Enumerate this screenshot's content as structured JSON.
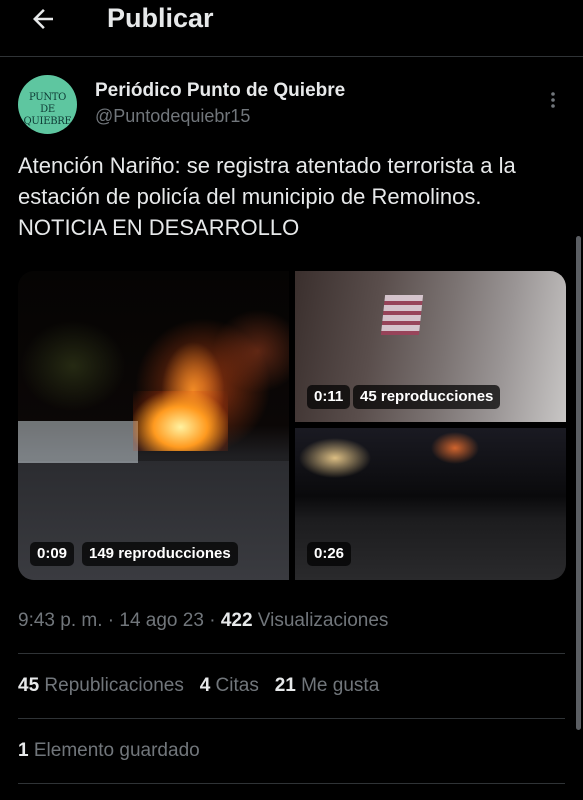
{
  "header": {
    "title": "Publicar",
    "back_icon": "arrow-left-icon"
  },
  "author": {
    "name": "Periódico Punto de Quiebre",
    "handle": "@Puntodequiebr15",
    "avatar_line1": "PUNTO",
    "avatar_line2": "DE QUIEBRE",
    "avatar_color": "#5ec6a0"
  },
  "tweet": {
    "text": "Atención Nariño: se registra atentado terrorista a la estación de policía del municipio de Remolinos. NOTICIA EN DESARROLLO"
  },
  "media": [
    {
      "duration": "0:09",
      "views": "149 reproducciones"
    },
    {
      "duration": "0:11",
      "views": "45 reproducciones"
    },
    {
      "duration": "0:26"
    }
  ],
  "stats": {
    "time": "9:43 p. m.",
    "sep1": "·",
    "date": "14 ago 23",
    "sep2": "·",
    "views_count": "422",
    "views_label": "Visualizaciones"
  },
  "engagement": {
    "reposts_count": "45",
    "reposts_label": "Republicaciones",
    "quotes_count": "4",
    "quotes_label": "Citas",
    "likes_count": "21",
    "likes_label": "Me gusta",
    "saved_count": "1",
    "saved_label": "Elemento guardado"
  },
  "colors": {
    "background": "#000000",
    "text": "#e7e9ea",
    "muted": "#71767b",
    "divider": "#2f3336"
  }
}
